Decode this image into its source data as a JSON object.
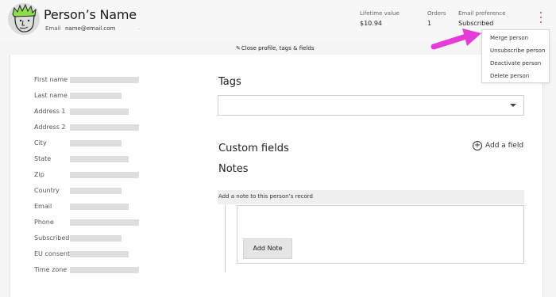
{
  "person": {
    "name": "Person’s Name",
    "email_label": "Email",
    "email": "name@email.com",
    "extra": "."
  },
  "stats": {
    "lifetime_label": "Lifetime value",
    "lifetime_value": "$10.94",
    "orders_label": "Orders",
    "orders_value": "1",
    "pref_label": "Email preference",
    "pref_value": "Subscribed"
  },
  "close_link": "Close profile, tags & fields",
  "menu": {
    "items": [
      "Merge person",
      "Unsubscribe person",
      "Deactivate person",
      "Delete person"
    ]
  },
  "fields": [
    {
      "label": "First name",
      "fill": 1.0
    },
    {
      "label": "Last name",
      "fill": 0.75
    },
    {
      "label": "Address 1",
      "fill": 0.85
    },
    {
      "label": "Address 2",
      "fill": 1.0
    },
    {
      "label": "City",
      "fill": 0.75
    },
    {
      "label": "State",
      "fill": 0.85
    },
    {
      "label": "Zip",
      "fill": 1.0
    },
    {
      "label": "Country",
      "fill": 0.75
    },
    {
      "label": "Email",
      "fill": 0.85
    },
    {
      "label": "Phone",
      "fill": 1.0
    },
    {
      "label": "Subscribed",
      "fill": 0.75
    },
    {
      "label": "EU consent",
      "fill": 0.85
    },
    {
      "label": "Time zone",
      "fill": 1.0
    }
  ],
  "tags": {
    "title": "Tags"
  },
  "custom_fields": {
    "title": "Custom fields",
    "add_label": "Add a field",
    "plus": "+"
  },
  "notes": {
    "title": "Notes",
    "header": "Add a note to this person’s record",
    "button": "Add Note"
  },
  "colors": {
    "accent": "#e0407a",
    "arrow": "#e63cd6",
    "avatar_hair": "#8be04a"
  },
  "icons": {
    "avatar": "avatar-face-icon",
    "kebab": "kebab-menu-icon",
    "pencil": "pencil-icon",
    "caret": "chevron-down-icon",
    "plus": "plus-circle-icon",
    "arrow": "pointer-arrow-icon"
  }
}
